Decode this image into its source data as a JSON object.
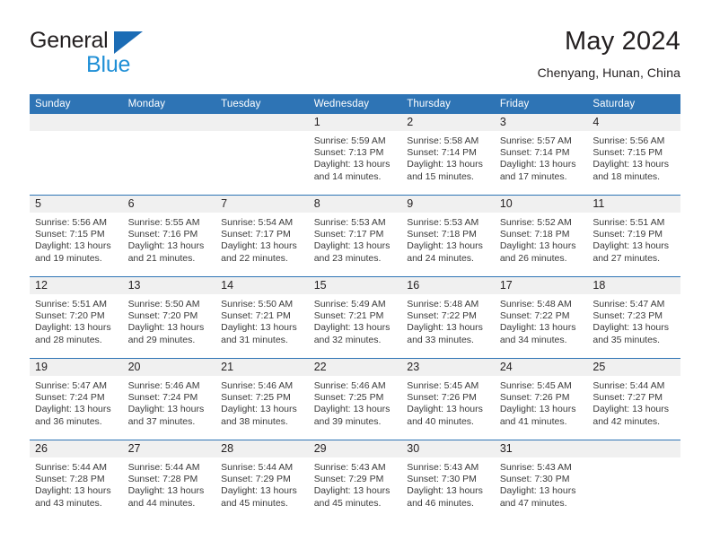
{
  "brand": {
    "line1": "General",
    "line2": "Blue",
    "triangle_color": "#1b6cb5",
    "line2_color": "#1f8fd6"
  },
  "header": {
    "title": "May 2024",
    "subtitle": "Chenyang, Hunan, China"
  },
  "theme": {
    "header_blue": "#2e74b5",
    "daynum_gray": "#f0f0f0",
    "text": "#231f20"
  },
  "weekdays": [
    "Sunday",
    "Monday",
    "Tuesday",
    "Wednesday",
    "Thursday",
    "Friday",
    "Saturday"
  ],
  "labels": {
    "sunrise_prefix": "Sunrise:",
    "sunset_prefix": "Sunset:",
    "daylight_prefix": "Daylight:"
  },
  "weeks": [
    [
      {
        "day": "",
        "blank": true
      },
      {
        "day": "",
        "blank": true
      },
      {
        "day": "",
        "blank": true
      },
      {
        "day": "1",
        "sunrise": "Sunrise: 5:59 AM",
        "sunset": "Sunset: 7:13 PM",
        "daylight1": "Daylight: 13 hours",
        "daylight2": "and 14 minutes."
      },
      {
        "day": "2",
        "sunrise": "Sunrise: 5:58 AM",
        "sunset": "Sunset: 7:14 PM",
        "daylight1": "Daylight: 13 hours",
        "daylight2": "and 15 minutes."
      },
      {
        "day": "3",
        "sunrise": "Sunrise: 5:57 AM",
        "sunset": "Sunset: 7:14 PM",
        "daylight1": "Daylight: 13 hours",
        "daylight2": "and 17 minutes."
      },
      {
        "day": "4",
        "sunrise": "Sunrise: 5:56 AM",
        "sunset": "Sunset: 7:15 PM",
        "daylight1": "Daylight: 13 hours",
        "daylight2": "and 18 minutes."
      }
    ],
    [
      {
        "day": "5",
        "sunrise": "Sunrise: 5:56 AM",
        "sunset": "Sunset: 7:15 PM",
        "daylight1": "Daylight: 13 hours",
        "daylight2": "and 19 minutes."
      },
      {
        "day": "6",
        "sunrise": "Sunrise: 5:55 AM",
        "sunset": "Sunset: 7:16 PM",
        "daylight1": "Daylight: 13 hours",
        "daylight2": "and 21 minutes."
      },
      {
        "day": "7",
        "sunrise": "Sunrise: 5:54 AM",
        "sunset": "Sunset: 7:17 PM",
        "daylight1": "Daylight: 13 hours",
        "daylight2": "and 22 minutes."
      },
      {
        "day": "8",
        "sunrise": "Sunrise: 5:53 AM",
        "sunset": "Sunset: 7:17 PM",
        "daylight1": "Daylight: 13 hours",
        "daylight2": "and 23 minutes."
      },
      {
        "day": "9",
        "sunrise": "Sunrise: 5:53 AM",
        "sunset": "Sunset: 7:18 PM",
        "daylight1": "Daylight: 13 hours",
        "daylight2": "and 24 minutes."
      },
      {
        "day": "10",
        "sunrise": "Sunrise: 5:52 AM",
        "sunset": "Sunset: 7:18 PM",
        "daylight1": "Daylight: 13 hours",
        "daylight2": "and 26 minutes."
      },
      {
        "day": "11",
        "sunrise": "Sunrise: 5:51 AM",
        "sunset": "Sunset: 7:19 PM",
        "daylight1": "Daylight: 13 hours",
        "daylight2": "and 27 minutes."
      }
    ],
    [
      {
        "day": "12",
        "sunrise": "Sunrise: 5:51 AM",
        "sunset": "Sunset: 7:20 PM",
        "daylight1": "Daylight: 13 hours",
        "daylight2": "and 28 minutes."
      },
      {
        "day": "13",
        "sunrise": "Sunrise: 5:50 AM",
        "sunset": "Sunset: 7:20 PM",
        "daylight1": "Daylight: 13 hours",
        "daylight2": "and 29 minutes."
      },
      {
        "day": "14",
        "sunrise": "Sunrise: 5:50 AM",
        "sunset": "Sunset: 7:21 PM",
        "daylight1": "Daylight: 13 hours",
        "daylight2": "and 31 minutes."
      },
      {
        "day": "15",
        "sunrise": "Sunrise: 5:49 AM",
        "sunset": "Sunset: 7:21 PM",
        "daylight1": "Daylight: 13 hours",
        "daylight2": "and 32 minutes."
      },
      {
        "day": "16",
        "sunrise": "Sunrise: 5:48 AM",
        "sunset": "Sunset: 7:22 PM",
        "daylight1": "Daylight: 13 hours",
        "daylight2": "and 33 minutes."
      },
      {
        "day": "17",
        "sunrise": "Sunrise: 5:48 AM",
        "sunset": "Sunset: 7:22 PM",
        "daylight1": "Daylight: 13 hours",
        "daylight2": "and 34 minutes."
      },
      {
        "day": "18",
        "sunrise": "Sunrise: 5:47 AM",
        "sunset": "Sunset: 7:23 PM",
        "daylight1": "Daylight: 13 hours",
        "daylight2": "and 35 minutes."
      }
    ],
    [
      {
        "day": "19",
        "sunrise": "Sunrise: 5:47 AM",
        "sunset": "Sunset: 7:24 PM",
        "daylight1": "Daylight: 13 hours",
        "daylight2": "and 36 minutes."
      },
      {
        "day": "20",
        "sunrise": "Sunrise: 5:46 AM",
        "sunset": "Sunset: 7:24 PM",
        "daylight1": "Daylight: 13 hours",
        "daylight2": "and 37 minutes."
      },
      {
        "day": "21",
        "sunrise": "Sunrise: 5:46 AM",
        "sunset": "Sunset: 7:25 PM",
        "daylight1": "Daylight: 13 hours",
        "daylight2": "and 38 minutes."
      },
      {
        "day": "22",
        "sunrise": "Sunrise: 5:46 AM",
        "sunset": "Sunset: 7:25 PM",
        "daylight1": "Daylight: 13 hours",
        "daylight2": "and 39 minutes."
      },
      {
        "day": "23",
        "sunrise": "Sunrise: 5:45 AM",
        "sunset": "Sunset: 7:26 PM",
        "daylight1": "Daylight: 13 hours",
        "daylight2": "and 40 minutes."
      },
      {
        "day": "24",
        "sunrise": "Sunrise: 5:45 AM",
        "sunset": "Sunset: 7:26 PM",
        "daylight1": "Daylight: 13 hours",
        "daylight2": "and 41 minutes."
      },
      {
        "day": "25",
        "sunrise": "Sunrise: 5:44 AM",
        "sunset": "Sunset: 7:27 PM",
        "daylight1": "Daylight: 13 hours",
        "daylight2": "and 42 minutes."
      }
    ],
    [
      {
        "day": "26",
        "sunrise": "Sunrise: 5:44 AM",
        "sunset": "Sunset: 7:28 PM",
        "daylight1": "Daylight: 13 hours",
        "daylight2": "and 43 minutes."
      },
      {
        "day": "27",
        "sunrise": "Sunrise: 5:44 AM",
        "sunset": "Sunset: 7:28 PM",
        "daylight1": "Daylight: 13 hours",
        "daylight2": "and 44 minutes."
      },
      {
        "day": "28",
        "sunrise": "Sunrise: 5:44 AM",
        "sunset": "Sunset: 7:29 PM",
        "daylight1": "Daylight: 13 hours",
        "daylight2": "and 45 minutes."
      },
      {
        "day": "29",
        "sunrise": "Sunrise: 5:43 AM",
        "sunset": "Sunset: 7:29 PM",
        "daylight1": "Daylight: 13 hours",
        "daylight2": "and 45 minutes."
      },
      {
        "day": "30",
        "sunrise": "Sunrise: 5:43 AM",
        "sunset": "Sunset: 7:30 PM",
        "daylight1": "Daylight: 13 hours",
        "daylight2": "and 46 minutes."
      },
      {
        "day": "31",
        "sunrise": "Sunrise: 5:43 AM",
        "sunset": "Sunset: 7:30 PM",
        "daylight1": "Daylight: 13 hours",
        "daylight2": "and 47 minutes."
      },
      {
        "day": "",
        "blank": true
      }
    ]
  ]
}
